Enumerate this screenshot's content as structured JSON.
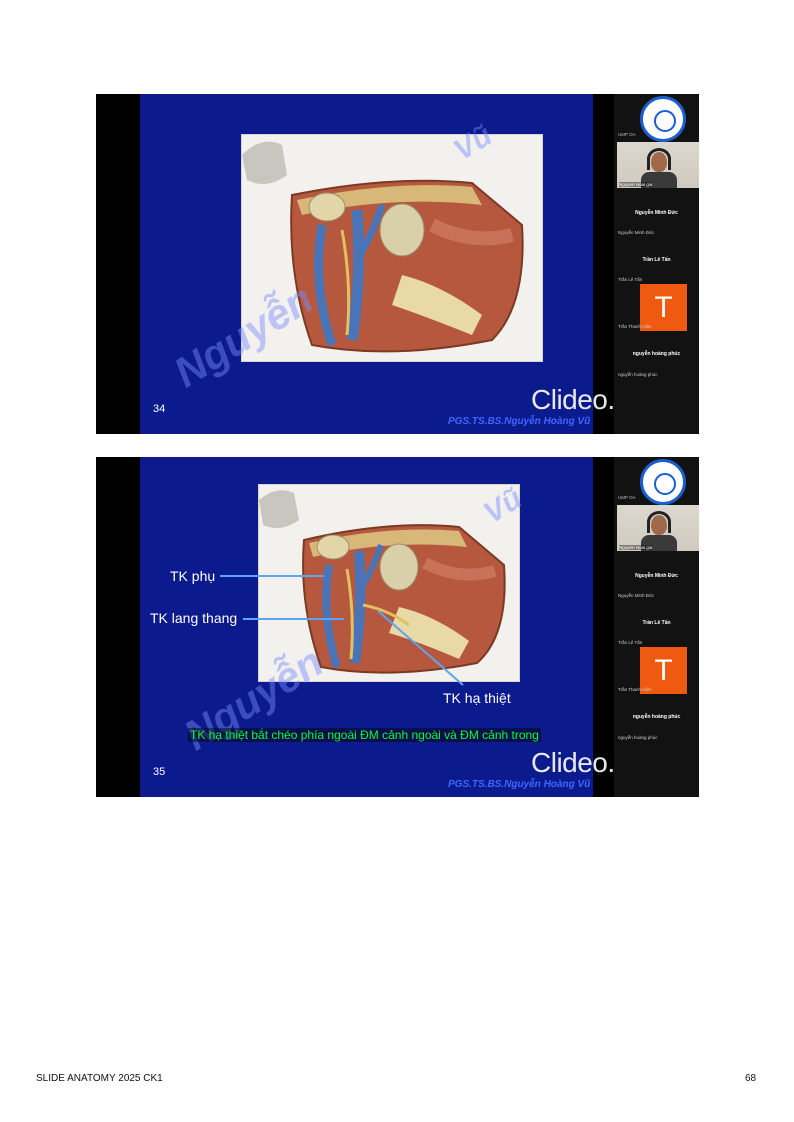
{
  "slides": [
    {
      "number": "34",
      "author": "PGS.TS.BS.Nguyễn Hoàng Vũ",
      "watermark": "Clideo.com",
      "participants": {
        "logo_caption": "UMP OA",
        "video_caption": "Nguyen Hoai gia",
        "names": [
          "Nguyễn Minh Đức",
          "Trần Lê Tấn",
          "nguyễn hoàng phúc"
        ],
        "subs": [
          "Nguyễn Minh Đức",
          "Trần Lê Tấn",
          "Trần Thanh Hiền",
          "nguyễn hoàng phúc"
        ],
        "tile_letter": "T"
      }
    },
    {
      "number": "35",
      "author": "PGS.TS.BS.Nguyễn Hoàng Vũ",
      "watermark": "Clideo.com",
      "labels": {
        "tk_phu": "TK phụ",
        "tk_lang_thang": "TK lang thang",
        "tk_ha_thiet": "TK hạ thiệt"
      },
      "caption": "TK hạ thiệt bắt chéo phía ngoài ĐM cảnh ngoài và ĐM cảnh trong",
      "participants": {
        "logo_caption": "UMP OA",
        "video_caption": "Nguyen Hoai gia",
        "names": [
          "Nguyễn Minh Đức",
          "Trần Lê Tấn",
          "nguyễn hoàng phúc"
        ],
        "subs": [
          "Nguyễn Minh Đức",
          "Trần Lê Tấn",
          "Trần Thanh Hiền",
          "nguyễn hoàng phúc"
        ],
        "tile_letter": "T"
      }
    }
  ],
  "footer": {
    "left": "SLIDE ANATOMY 2025 CK1",
    "page": "68"
  }
}
